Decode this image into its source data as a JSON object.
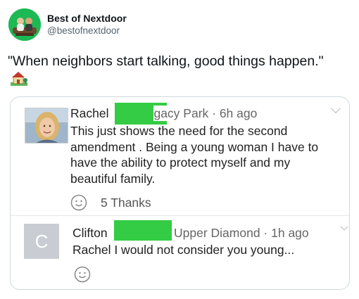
{
  "tweet": {
    "display_name": "Best of Nextdoor",
    "handle": "@bestofnextdoor",
    "text": "\"When neighbors start talking, good things happen.\"",
    "emoji": "house-with-garden-icon"
  },
  "embed": {
    "comments": [
      {
        "author": "Rachel",
        "meta": "Legacy Park · 6h ago",
        "body": "This just shows the need for the second amendment . Being a young woman I have to have the ability to protect myself and my beautiful family.",
        "thanks": "5 Thanks",
        "avatar_type": "photo"
      },
      {
        "author": "Clifton",
        "meta": "Upper Diamond · 1h ago",
        "body": "Rachel I would not consider you young...",
        "avatar_letter": "C"
      }
    ],
    "redaction_color": "#33cc44"
  }
}
